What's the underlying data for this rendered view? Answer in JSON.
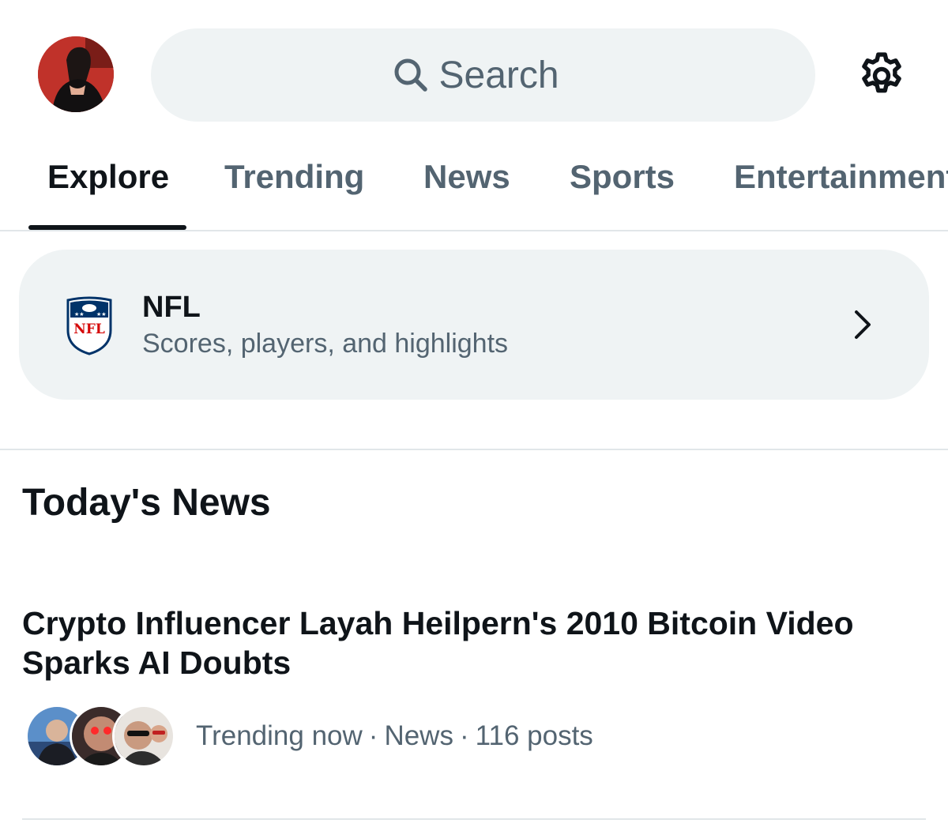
{
  "header": {
    "search": {
      "placeholder": "Search"
    }
  },
  "tabs": [
    {
      "label": "Explore",
      "active": true
    },
    {
      "label": "Trending",
      "active": false
    },
    {
      "label": "News",
      "active": false
    },
    {
      "label": "Sports",
      "active": false
    },
    {
      "label": "Entertainment",
      "active": false
    }
  ],
  "nfl_card": {
    "title": "NFL",
    "subtitle": "Scores, players, and highlights",
    "logo_icon": "nfl-shield-icon"
  },
  "todays_news": {
    "title": "Today's News",
    "items": [
      {
        "headline": "Crypto Influencer Layah Heilpern's 2010 Bitcoin Video Sparks AI Doubts",
        "status": "Trending now",
        "category": "News",
        "posts": "116 posts"
      }
    ]
  },
  "colors": {
    "text_primary": "#0f1419",
    "text_secondary": "#536471",
    "surface": "#eff3f4",
    "divider": "#e1e6e9",
    "nfl_blue": "#013369",
    "nfl_red": "#d50a0a"
  }
}
